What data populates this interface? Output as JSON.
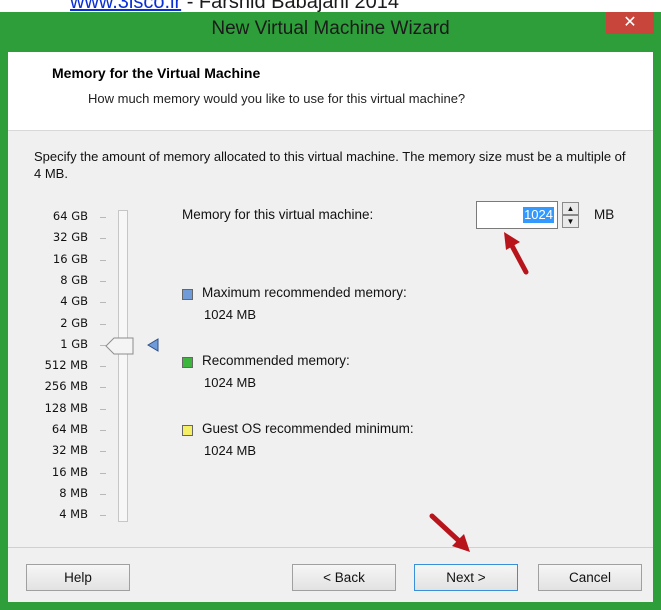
{
  "watermark": {
    "link_text": "www.3isco.ir",
    "rest": " - Farshid Babajani 2014"
  },
  "window": {
    "title": "New Virtual Machine Wizard",
    "close_glyph": "✕"
  },
  "header": {
    "title": "Memory for the Virtual Machine",
    "subtitle": "How much memory would you like to use for this virtual machine?"
  },
  "description": "Specify the amount of memory allocated to this virtual machine. The memory size must be a multiple of 4 MB.",
  "scale": [
    "64 GB",
    "32 GB",
    "16 GB",
    "8 GB",
    "4 GB",
    "2 GB",
    "1 GB",
    "512 MB",
    "256 MB",
    "128 MB",
    "64 MB",
    "32 MB",
    "16 MB",
    "8 MB",
    "4 MB"
  ],
  "memory": {
    "label": "Memory for this virtual machine:",
    "value": "1024",
    "unit": "MB",
    "selected_scale": "1 GB"
  },
  "legend": [
    {
      "label": "Maximum recommended memory:",
      "value": "1024 MB",
      "color": "#6f9bd8"
    },
    {
      "label": "Recommended memory:",
      "value": "1024 MB",
      "color": "#3cb53c"
    },
    {
      "label": "Guest OS recommended minimum:",
      "value": "1024 MB",
      "color": "#f5ef66"
    }
  ],
  "buttons": {
    "help": "Help",
    "back": "< Back",
    "next": "Next >",
    "cancel": "Cancel"
  },
  "colors": {
    "title_bar": "#2e9e3a",
    "close": "#c7453b",
    "arrow": "#b8141b",
    "selection": "#3399ff"
  },
  "icons": {
    "spin_up": "▲",
    "spin_down": "▼"
  }
}
